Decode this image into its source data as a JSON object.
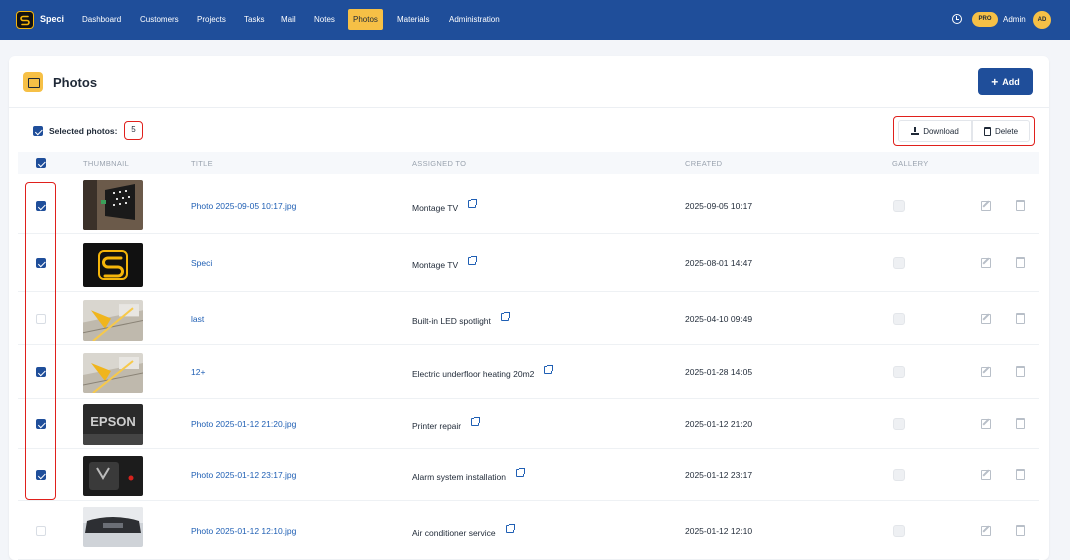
{
  "colors": {
    "navbar": "#1f4e9a",
    "accent": "#f6c046",
    "link": "#1f5fb4",
    "highlight": "#e0201c"
  },
  "navbar": {
    "brand": "Speci",
    "items": [
      {
        "label": "Dashboard"
      },
      {
        "label": "Customers"
      },
      {
        "label": "Projects"
      },
      {
        "label": "Tasks"
      },
      {
        "label": "Mail"
      },
      {
        "label": "Notes"
      },
      {
        "label": "Photos",
        "active": true
      },
      {
        "label": "Materials"
      },
      {
        "label": "Administration"
      }
    ],
    "badge": "PRO",
    "user": "Admin",
    "avatar_initials": "AD"
  },
  "page": {
    "title": "Photos",
    "add_label": "Add"
  },
  "toolbar": {
    "selected_label": "Selected photos:",
    "selected_count": "5",
    "download_label": "Download",
    "delete_label": "Delete"
  },
  "table": {
    "headers": [
      "THUMBNAIL",
      "TITLE",
      "ASSIGNED TO",
      "CREATED",
      "GALLERY"
    ],
    "rows": [
      {
        "checked": true,
        "title": "Photo 2025-09-05 10:17.jpg",
        "assigned": "Montage TV",
        "created": "2025-09-05 10:17",
        "thumb": "tv-wall"
      },
      {
        "checked": true,
        "title": "Speci",
        "assigned": "Montage TV",
        "created": "2025-08-01 14:47",
        "thumb": "speci-logo"
      },
      {
        "checked": false,
        "title": "last",
        "assigned": "Built-in LED spotlight",
        "created": "2025-04-10 09:49",
        "thumb": "construction"
      },
      {
        "checked": true,
        "title": "12+",
        "assigned": "Electric underfloor heating 20m2",
        "created": "2025-01-28 14:05",
        "thumb": "construction"
      },
      {
        "checked": true,
        "title": "Photo 2025-01-12 21:20.jpg",
        "assigned": "Printer repair",
        "created": "2025-01-12 21:20",
        "thumb": "epson"
      },
      {
        "checked": true,
        "title": "Photo 2025-01-12 23:17.jpg",
        "assigned": "Alarm system installation",
        "created": "2025-01-12 23:17",
        "thumb": "alarm"
      },
      {
        "checked": false,
        "title": "Photo 2025-01-12 12:10.jpg",
        "assigned": "Air conditioner service",
        "created": "2025-01-12 12:10",
        "thumb": "car"
      }
    ]
  }
}
